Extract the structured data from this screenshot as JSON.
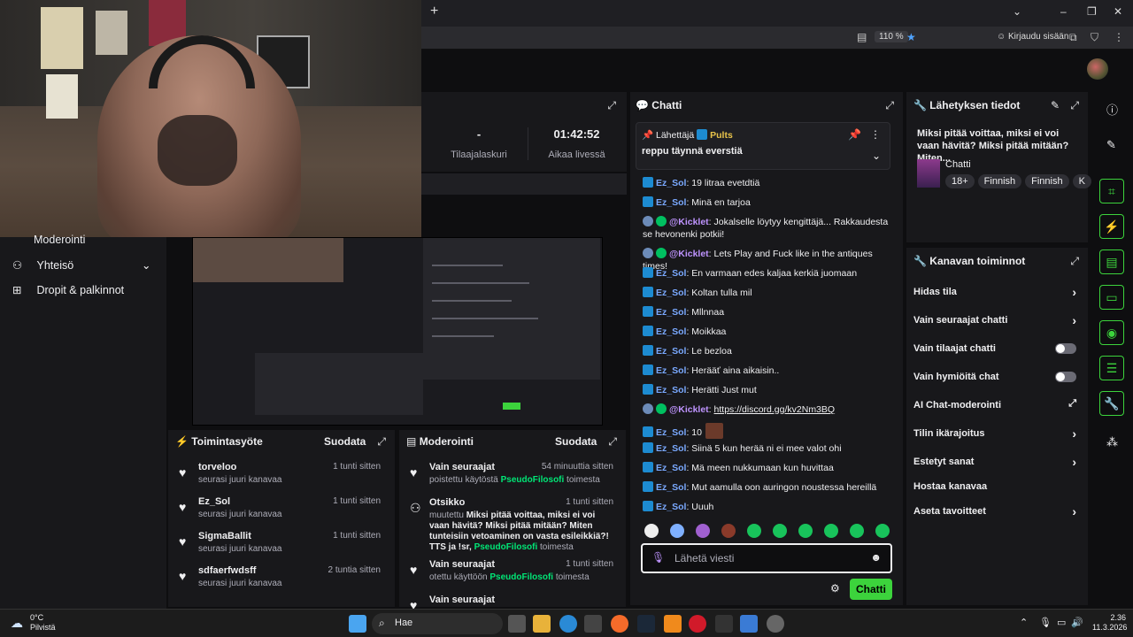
{
  "browser": {
    "zoom": "110 %",
    "login_label": "Kirjaudu sisään",
    "newtab_icon": "plus-icon"
  },
  "nav": {
    "moderation": "Moderointi",
    "community": "Yhteisö",
    "drops": "Dropit & palkinnot"
  },
  "stats": {
    "subs_value": "-",
    "subs_label": "Tilaajalaskuri",
    "live_value": "01:42:52",
    "live_label": "Aikaa livessä"
  },
  "chat": {
    "title": "Chatti",
    "pinned_prefix": "Lähettäjä",
    "pinned_sender": "Pults",
    "pinned_message": "reppu täynnä everstiä",
    "messages": [
      {
        "user": "Ez_Sol",
        "text": ": 19 litraa evetdtiä",
        "type": "sub"
      },
      {
        "user": "Ez_Sol",
        "text": ": Minä en tarjoa",
        "type": "sub"
      },
      {
        "user": "@Kicklet",
        "text": ": Jokalselle löytyy kengittäjä... Rakkaudesta se hevonenki potkii!",
        "type": "bot"
      },
      {
        "user": "@Kicklet",
        "text": ": Lets Play and Fuck like in the antiques times!",
        "type": "bot"
      },
      {
        "user": "Ez_Sol",
        "text": ": En varmaan edes kaljaa kerkiä juomaan",
        "type": "sub"
      },
      {
        "user": "Ez_Sol",
        "text": ": Koltan tulla mil",
        "type": "sub"
      },
      {
        "user": "Ez_Sol",
        "text": ": Mllnnaa",
        "type": "sub"
      },
      {
        "user": "Ez_Sol",
        "text": ": Moikkaa",
        "type": "sub"
      },
      {
        "user": "Ez_Sol",
        "text": ": Le bezloa",
        "type": "sub"
      },
      {
        "user": "Ez_Sol",
        "text": ": Herääť aina aikaisin..",
        "type": "sub"
      },
      {
        "user": "Ez_Sol",
        "text": ": Herätti Just mut",
        "type": "sub"
      },
      {
        "user": "@Kicklet",
        "text": ": ",
        "link": "https://discord.gg/kv2Nm3BQ",
        "type": "bot"
      },
      {
        "user": "Ez_Sol",
        "text": ": 10",
        "type": "sub"
      },
      {
        "user": "Ez_Sol",
        "text": ": Siinä 5 kun herää ni ei mee valot ohi",
        "type": "sub"
      },
      {
        "user": "Ez_Sol",
        "text": ": Mä meen nukkumaan kun huvittaa",
        "type": "sub"
      },
      {
        "user": "Ez_Sol",
        "text": ": Mut aamulla oon auringon noustessa hereillä",
        "type": "sub"
      },
      {
        "user": "Ez_Sol",
        "text": ": Uuuh",
        "type": "sub"
      }
    ],
    "input_placeholder": "Lähetä viesti",
    "send_label": "Chatti"
  },
  "info": {
    "title": "Lähetyksen tiedot",
    "stream_title": "Miksi pitää voittaa, miksi ei voi vaan hävitä? Miksi pitää mitään? Miten...",
    "category": "Chatti",
    "tags": [
      "18+",
      "Finnish",
      "Finnish",
      "K"
    ]
  },
  "actions": {
    "title": "Kanavan toiminnot",
    "items": [
      {
        "label": "Hidas tila",
        "control": "chevron"
      },
      {
        "label": "Vain seuraajat chatti",
        "control": "chevron"
      },
      {
        "label": "Vain tilaajat chatti",
        "control": "toggle"
      },
      {
        "label": "Vain hymiöitä chat",
        "control": "toggle"
      },
      {
        "label": "AI Chat-moderointi",
        "control": "external"
      },
      {
        "label": "Tilin ikärajoitus",
        "control": "chevron"
      },
      {
        "label": "Estetyt sanat",
        "control": "chevron"
      },
      {
        "label": "Hostaa kanavaa",
        "control": "none"
      },
      {
        "label": "Aseta tavoitteet",
        "control": "chevron"
      }
    ]
  },
  "feed": {
    "title": "Toimintasyöte",
    "filter": "Suodata",
    "rows": [
      {
        "name": "torveloo",
        "sub": "seurasi juuri kanavaa",
        "time": "1 tunti sitten"
      },
      {
        "name": "Ez_Sol",
        "sub": "seurasi juuri kanavaa",
        "time": "1 tunti sitten"
      },
      {
        "name": "SigmaBallit",
        "sub": "seurasi juuri kanavaa",
        "time": "1 tunti sitten"
      },
      {
        "name": "sdfaerfwdsff",
        "sub": "seurasi juuri kanavaa",
        "time": "2 tuntia sitten"
      }
    ]
  },
  "moderation": {
    "title": "Moderointi",
    "filter": "Suodata",
    "rows": [
      {
        "name": "Vain seuraajat",
        "pre": "poistettu käytöstä ",
        "who": "PseudoFilosofi",
        "post": " toimesta",
        "time": "54 minuuttia sitten"
      },
      {
        "name": "Otsikko",
        "pre": "muutettu ",
        "bold": "Miksi pitää voittaa, miksi ei voi vaan hävitä? Miksi pitää mitään? Miten tunteisiin vetoaminen on vasta esileikkiä?! TTS ja !sr, ",
        "who": "PseudoFilosofi",
        "post": " toimesta",
        "time": "1 tunti sitten"
      },
      {
        "name": "Vain seuraajat",
        "pre": "otettu käyttöön ",
        "who": "PseudoFilosofi",
        "post": " toimesta",
        "time": "1 tunti sitten"
      },
      {
        "name": "Vain seuraajat",
        "pre": "",
        "who": "",
        "post": "",
        "time": ""
      }
    ]
  },
  "taskbar": {
    "weather_temp": "0°C",
    "weather_desc": "Pilvistä",
    "search": "Hae",
    "time": "2.36",
    "date": "11.3.2026"
  },
  "colors": {
    "accent_green": "#3cd33c",
    "purple": "#bf94ff",
    "bg": "#0e0e10",
    "panel": "#18181b"
  }
}
